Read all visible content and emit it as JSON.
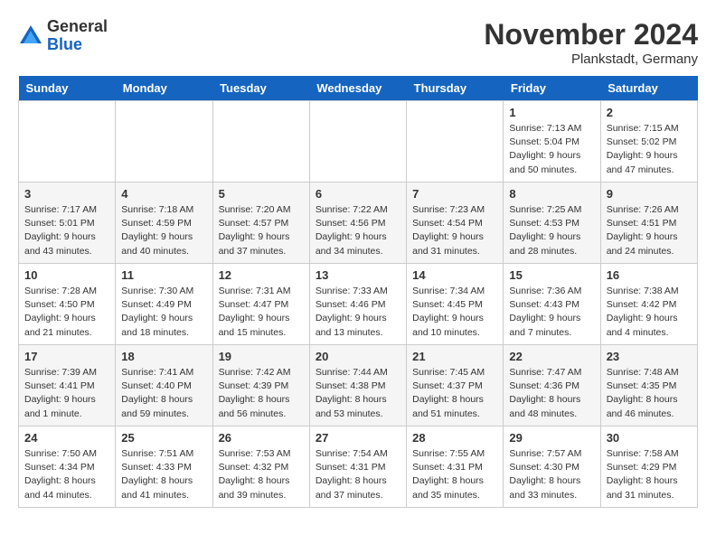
{
  "header": {
    "logo": {
      "line1": "General",
      "line2": "Blue"
    },
    "title": "November 2024",
    "location": "Plankstadt, Germany"
  },
  "weekdays": [
    "Sunday",
    "Monday",
    "Tuesday",
    "Wednesday",
    "Thursday",
    "Friday",
    "Saturday"
  ],
  "weeks": [
    [
      {
        "day": null,
        "info": ""
      },
      {
        "day": null,
        "info": ""
      },
      {
        "day": null,
        "info": ""
      },
      {
        "day": null,
        "info": ""
      },
      {
        "day": null,
        "info": ""
      },
      {
        "day": "1",
        "info": "Sunrise: 7:13 AM\nSunset: 5:04 PM\nDaylight: 9 hours\nand 50 minutes."
      },
      {
        "day": "2",
        "info": "Sunrise: 7:15 AM\nSunset: 5:02 PM\nDaylight: 9 hours\nand 47 minutes."
      }
    ],
    [
      {
        "day": "3",
        "info": "Sunrise: 7:17 AM\nSunset: 5:01 PM\nDaylight: 9 hours\nand 43 minutes."
      },
      {
        "day": "4",
        "info": "Sunrise: 7:18 AM\nSunset: 4:59 PM\nDaylight: 9 hours\nand 40 minutes."
      },
      {
        "day": "5",
        "info": "Sunrise: 7:20 AM\nSunset: 4:57 PM\nDaylight: 9 hours\nand 37 minutes."
      },
      {
        "day": "6",
        "info": "Sunrise: 7:22 AM\nSunset: 4:56 PM\nDaylight: 9 hours\nand 34 minutes."
      },
      {
        "day": "7",
        "info": "Sunrise: 7:23 AM\nSunset: 4:54 PM\nDaylight: 9 hours\nand 31 minutes."
      },
      {
        "day": "8",
        "info": "Sunrise: 7:25 AM\nSunset: 4:53 PM\nDaylight: 9 hours\nand 28 minutes."
      },
      {
        "day": "9",
        "info": "Sunrise: 7:26 AM\nSunset: 4:51 PM\nDaylight: 9 hours\nand 24 minutes."
      }
    ],
    [
      {
        "day": "10",
        "info": "Sunrise: 7:28 AM\nSunset: 4:50 PM\nDaylight: 9 hours\nand 21 minutes."
      },
      {
        "day": "11",
        "info": "Sunrise: 7:30 AM\nSunset: 4:49 PM\nDaylight: 9 hours\nand 18 minutes."
      },
      {
        "day": "12",
        "info": "Sunrise: 7:31 AM\nSunset: 4:47 PM\nDaylight: 9 hours\nand 15 minutes."
      },
      {
        "day": "13",
        "info": "Sunrise: 7:33 AM\nSunset: 4:46 PM\nDaylight: 9 hours\nand 13 minutes."
      },
      {
        "day": "14",
        "info": "Sunrise: 7:34 AM\nSunset: 4:45 PM\nDaylight: 9 hours\nand 10 minutes."
      },
      {
        "day": "15",
        "info": "Sunrise: 7:36 AM\nSunset: 4:43 PM\nDaylight: 9 hours\nand 7 minutes."
      },
      {
        "day": "16",
        "info": "Sunrise: 7:38 AM\nSunset: 4:42 PM\nDaylight: 9 hours\nand 4 minutes."
      }
    ],
    [
      {
        "day": "17",
        "info": "Sunrise: 7:39 AM\nSunset: 4:41 PM\nDaylight: 9 hours\nand 1 minute."
      },
      {
        "day": "18",
        "info": "Sunrise: 7:41 AM\nSunset: 4:40 PM\nDaylight: 8 hours\nand 59 minutes."
      },
      {
        "day": "19",
        "info": "Sunrise: 7:42 AM\nSunset: 4:39 PM\nDaylight: 8 hours\nand 56 minutes."
      },
      {
        "day": "20",
        "info": "Sunrise: 7:44 AM\nSunset: 4:38 PM\nDaylight: 8 hours\nand 53 minutes."
      },
      {
        "day": "21",
        "info": "Sunrise: 7:45 AM\nSunset: 4:37 PM\nDaylight: 8 hours\nand 51 minutes."
      },
      {
        "day": "22",
        "info": "Sunrise: 7:47 AM\nSunset: 4:36 PM\nDaylight: 8 hours\nand 48 minutes."
      },
      {
        "day": "23",
        "info": "Sunrise: 7:48 AM\nSunset: 4:35 PM\nDaylight: 8 hours\nand 46 minutes."
      }
    ],
    [
      {
        "day": "24",
        "info": "Sunrise: 7:50 AM\nSunset: 4:34 PM\nDaylight: 8 hours\nand 44 minutes."
      },
      {
        "day": "25",
        "info": "Sunrise: 7:51 AM\nSunset: 4:33 PM\nDaylight: 8 hours\nand 41 minutes."
      },
      {
        "day": "26",
        "info": "Sunrise: 7:53 AM\nSunset: 4:32 PM\nDaylight: 8 hours\nand 39 minutes."
      },
      {
        "day": "27",
        "info": "Sunrise: 7:54 AM\nSunset: 4:31 PM\nDaylight: 8 hours\nand 37 minutes."
      },
      {
        "day": "28",
        "info": "Sunrise: 7:55 AM\nSunset: 4:31 PM\nDaylight: 8 hours\nand 35 minutes."
      },
      {
        "day": "29",
        "info": "Sunrise: 7:57 AM\nSunset: 4:30 PM\nDaylight: 8 hours\nand 33 minutes."
      },
      {
        "day": "30",
        "info": "Sunrise: 7:58 AM\nSunset: 4:29 PM\nDaylight: 8 hours\nand 31 minutes."
      }
    ]
  ]
}
